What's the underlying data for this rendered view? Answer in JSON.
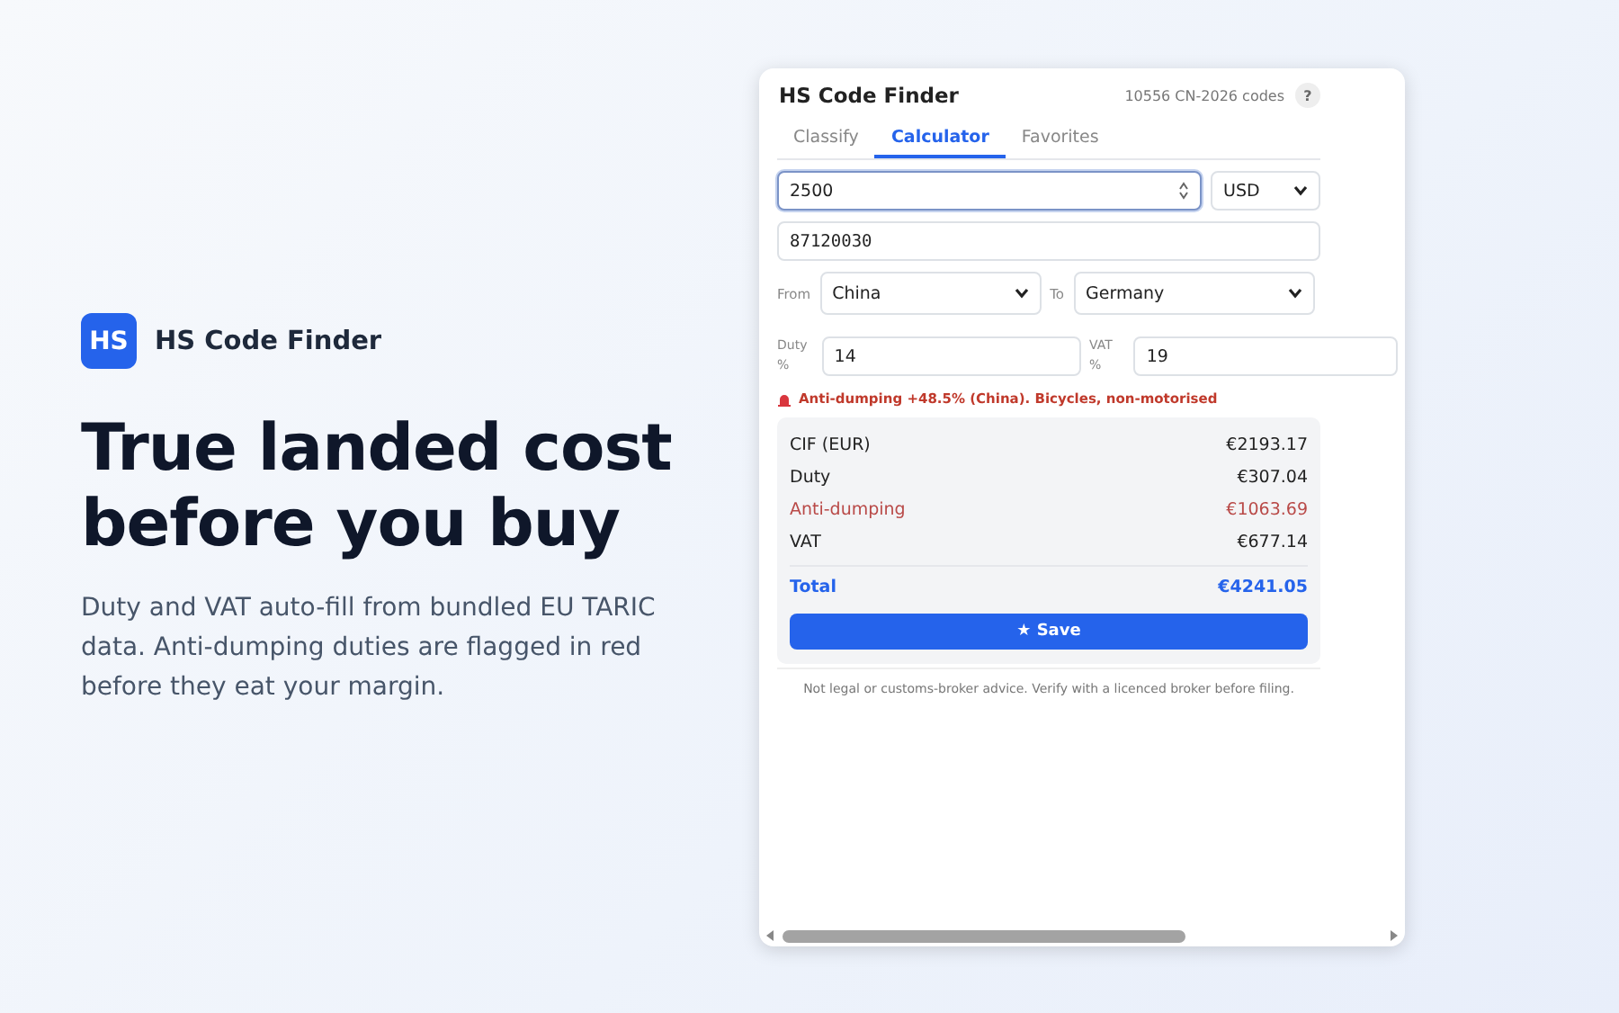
{
  "brand": {
    "logo": "HS",
    "name": "HS Code Finder"
  },
  "headline": [
    "True landed cost",
    "before you buy"
  ],
  "description": "Duty and VAT auto-fill from bundled EU TARIC data. Anti-dumping duties are flagged in red before they eat your margin.",
  "popup": {
    "title": "HS Code Finder",
    "code_count": "10556 CN-2026 codes",
    "help": "?",
    "tabs": [
      {
        "label": "Classify",
        "selected": false
      },
      {
        "label": "Calculator",
        "selected": true
      },
      {
        "label": "Favorites",
        "selected": false
      }
    ],
    "amount": {
      "value": "2500"
    },
    "currency": "USD",
    "hs_code": {
      "value": "87120030"
    },
    "from_label": "From",
    "from": "China",
    "to_label": "To",
    "to": "Germany",
    "duty_label": "Duty %",
    "duty": {
      "value": "14"
    },
    "vat_label": "VAT %",
    "vat": {
      "value": "19"
    },
    "warning": "Anti-dumping +48.5% (China). Bicycles, non-motorised",
    "results": [
      {
        "kind": "normal",
        "label": "CIF (EUR)",
        "value": "€2193.17"
      },
      {
        "kind": "normal",
        "label": "Duty",
        "value": "€307.04"
      },
      {
        "kind": "alert",
        "label": "Anti-dumping",
        "value": "€1063.69"
      },
      {
        "kind": "normal",
        "label": "VAT",
        "value": "€677.14"
      },
      {
        "kind": "total",
        "label": "Total",
        "value": "€4241.05"
      }
    ],
    "save": "★ Save",
    "disclaimer": "Not legal or customs-broker advice. Verify with a licenced broker before filing."
  }
}
